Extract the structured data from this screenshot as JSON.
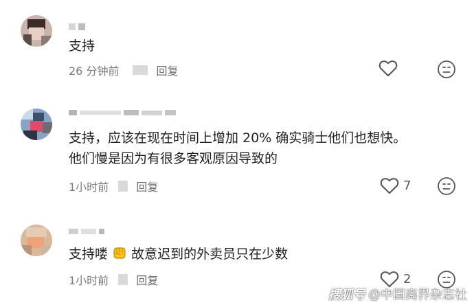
{
  "comments": [
    {
      "text_line1": "支持",
      "text_line2": "",
      "time": "26 分钟前",
      "reply_label": "回复",
      "like_count": ""
    },
    {
      "text_line1": "支持，应该在现在时间上增加 20% 确实骑士他们也想快。",
      "text_line2": "他们慢是因为有很多客观原因导致的",
      "time": "1小时前",
      "reply_label": "回复",
      "like_count": "7"
    },
    {
      "text_line1": "支持喽",
      "text_line1_after_emoji": "故意迟到的外卖员只在少数",
      "text_line2": "",
      "time": "1小时前",
      "reply_label": "回复",
      "like_count": "2"
    }
  ],
  "icons": {
    "like": "heart-outline-icon",
    "dislike": "neutral-face-icon",
    "emoji": "raised-fist-emoji"
  },
  "watermark": {
    "part1": "搜狐号",
    "part2": "@中国商界杂志社"
  }
}
